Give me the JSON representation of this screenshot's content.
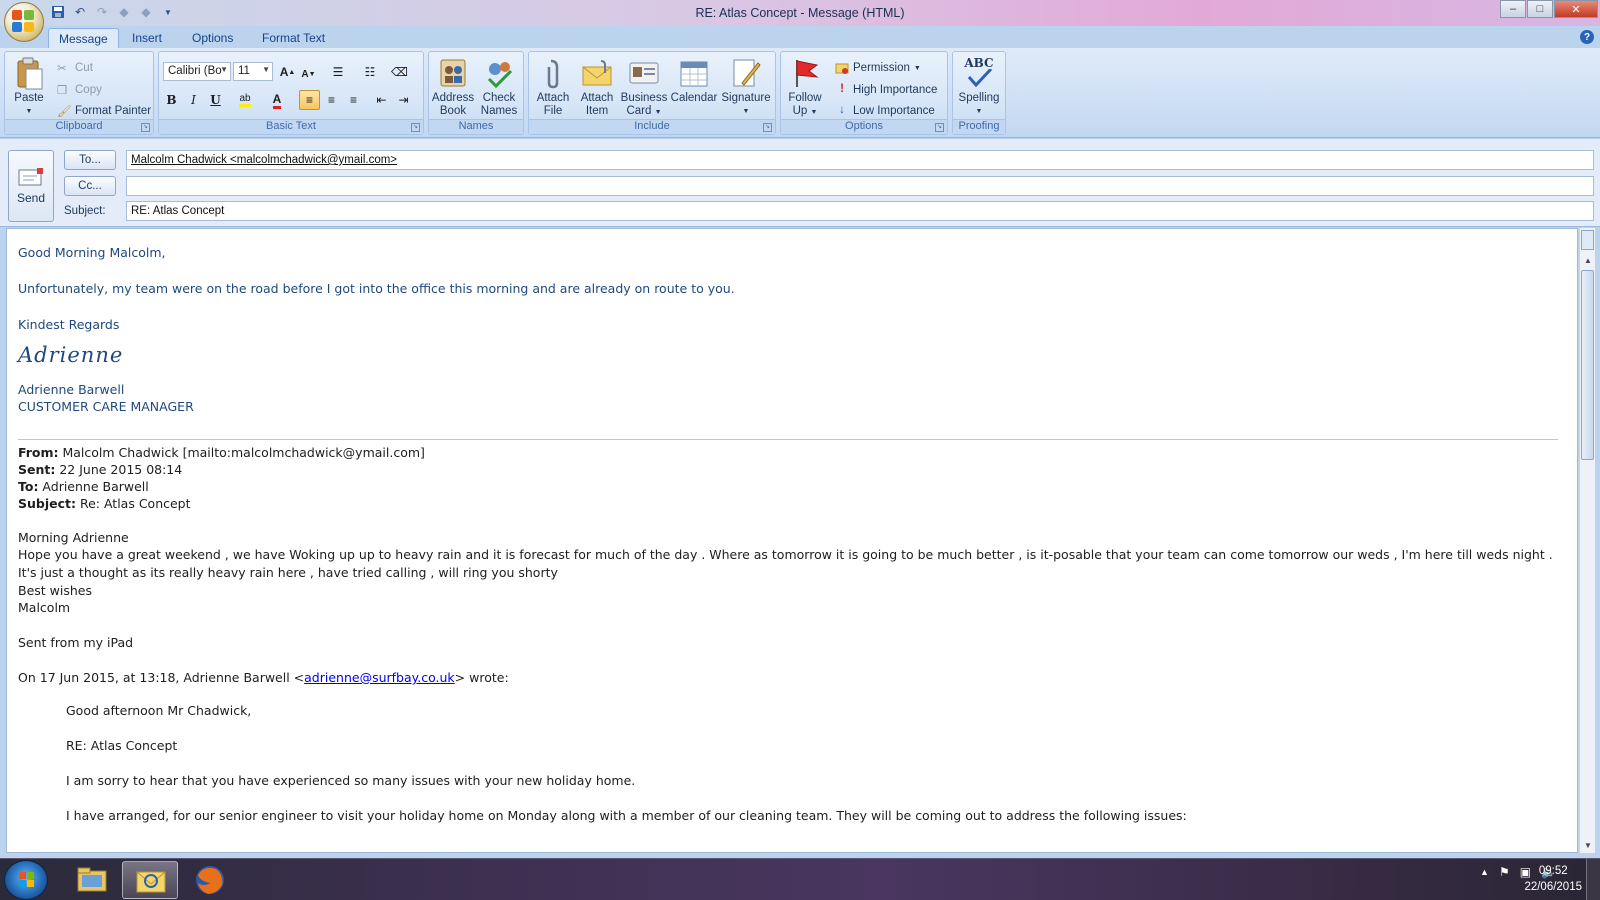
{
  "window": {
    "title": "RE: Atlas Concept  - Message (HTML)",
    "controls": {
      "minimize": "–",
      "maximize": "□",
      "close": "✕"
    }
  },
  "quick_access": [
    "save-icon",
    "undo-icon",
    "redo-icon",
    "up-icon",
    "down-icon",
    "customize-icon"
  ],
  "tabs": [
    {
      "label": "Message",
      "active": true
    },
    {
      "label": "Insert"
    },
    {
      "label": "Options"
    },
    {
      "label": "Format Text"
    }
  ],
  "help_label": "?",
  "ribbon": {
    "clipboard": {
      "group_label": "Clipboard",
      "paste": "Paste",
      "cut": "Cut",
      "copy": "Copy",
      "format_painter": "Format Painter"
    },
    "basic_text": {
      "group_label": "Basic Text",
      "font": "Calibri (Bo",
      "size": "11",
      "grow": "A",
      "shrink": "A",
      "bold": "B",
      "italic": "I",
      "underline": "U",
      "font_color_letter": "A"
    },
    "names": {
      "group_label": "Names",
      "address_book": [
        "Address",
        "Book"
      ],
      "check_names": [
        "Check",
        "Names"
      ]
    },
    "include": {
      "group_label": "Include",
      "attach_file": [
        "Attach",
        "File"
      ],
      "attach_item": [
        "Attach",
        "Item"
      ],
      "business_card": [
        "Business",
        "Card"
      ],
      "calendar": "Calendar",
      "signature": "Signature"
    },
    "options": {
      "group_label": "Options",
      "follow_up": [
        "Follow",
        "Up"
      ],
      "permission": "Permission",
      "high_importance": "High Importance",
      "low_importance": "Low Importance"
    },
    "proofing": {
      "group_label": "Proofing",
      "spelling": "Spelling",
      "abc": "ABC"
    }
  },
  "header": {
    "send": "Send",
    "to_button": "To...",
    "cc_button": "Cc...",
    "subject_label": "Subject:",
    "to_value": "Malcolm Chadwick <malcolmchadwick@ymail.com>",
    "cc_value": "",
    "subject_value": "RE: Atlas Concept"
  },
  "body": {
    "greeting": "Good Morning Malcolm,",
    "line1": "Unfortunately, my team were on the road before I got into the office this morning and are already on route to you.",
    "closing": "Kindest Regards",
    "signature_script": "Adrienne",
    "sig_name": "Adrienne Barwell",
    "sig_title": "CUSTOMER CARE MANAGER",
    "quoted": {
      "from_label": "From:",
      "from_value": " Malcolm Chadwick [mailto:malcolmchadwick@ymail.com]",
      "sent_label": "Sent:",
      "sent_value": " 22 June 2015 08:14",
      "to_label": "To:",
      "to_value": " Adrienne Barwell",
      "subject_label": "Subject:",
      "subject_value": " Re: Atlas Concept",
      "greet": "Morning Adrienne",
      "text": "Hope you have a great weekend , we have Woking up up to heavy rain and it is forecast for much of the day . Where as tomorrow it is going to be much better , is it-posable that your team can come tomorrow our weds , I'm here till weds night . It's just a thought as its really heavy rain here , have tried calling , will ring you shorty",
      "best": "Best wishes",
      "name": "Malcolm",
      "sent_from": "Sent from my iPad",
      "on_prefix": "On 17 Jun 2015, at 13:18, Adrienne Barwell <",
      "on_email": "adrienne@surfbay.co.uk",
      "on_suffix": "> wrote:",
      "inner_greet": "Good afternoon Mr Chadwick,",
      "inner_re": "RE: Atlas Concept",
      "inner_sorry": "I am sorry to hear that you have experienced so many issues with your new holiday home.",
      "inner_cut": "I have arranged, for our senior engineer to visit your holiday home on Monday along with a member of our cleaning team. They will be coming out to address the following issues:"
    }
  },
  "taskbar": {
    "items": [
      "file-explorer-icon",
      "outlook-icon",
      "firefox-icon"
    ],
    "time": "09:52",
    "date": "22/06/2015"
  },
  "colors": {
    "accent": "#1f497d",
    "ribbon": "#dfeaf8",
    "link": "#0000ee"
  }
}
